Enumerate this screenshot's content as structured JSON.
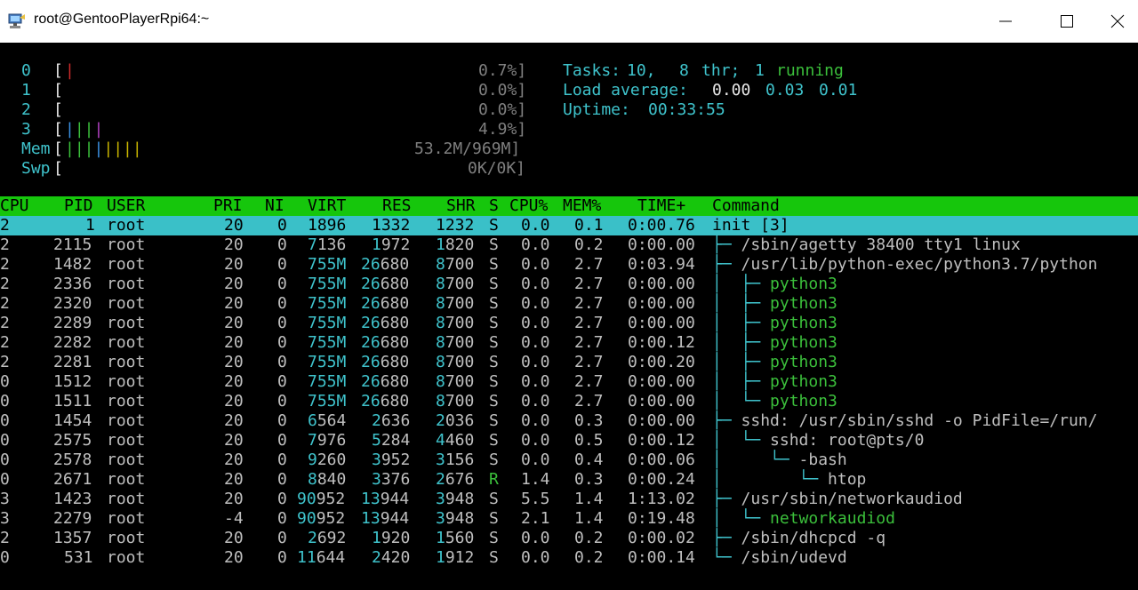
{
  "window": {
    "title": "root@GentooPlayerRpi64:~",
    "icons": [
      "app-icon",
      "minimize-icon",
      "maximize-icon",
      "close-icon"
    ]
  },
  "meters": {
    "cpus": [
      {
        "label": "0",
        "percent": "0.7%]"
      },
      {
        "label": "1",
        "percent": "0.0%]"
      },
      {
        "label": "2",
        "percent": "0.0%]"
      },
      {
        "label": "3",
        "percent": "4.9%]"
      }
    ],
    "mem": {
      "label": "Mem",
      "value": "53.2M/969M]"
    },
    "swp": {
      "label": "Swp",
      "value": "0K/0K]"
    }
  },
  "stats": {
    "tasks_label": "Tasks:",
    "tasks_value": "10,",
    "threads_value": "8",
    "threads_label": "thr;",
    "running_value": "1",
    "running_label": "running",
    "load_label": "Load average:",
    "load1": "0.00",
    "load5": "0.03",
    "load15": "0.01",
    "uptime_label": "Uptime:",
    "uptime_value": "00:33:55"
  },
  "table": {
    "headers": {
      "cpu": "CPU",
      "pid": "PID",
      "user": "USER",
      "pri": "PRI",
      "ni": "NI",
      "virt": "VIRT",
      "res": "RES",
      "shr": "SHR",
      "s": "S",
      "cpup": "CPU%",
      "memp": "MEM%",
      "time": "TIME+",
      "cmd": "Command"
    },
    "rows": [
      {
        "cpu": "2",
        "pid": "1",
        "user": "root",
        "pri": "20",
        "ni": "0",
        "virt": "1896",
        "res": "1332",
        "shr": "1232",
        "s": "S",
        "cpup": "0.0",
        "memp": "0.1",
        "time": "0:00.76",
        "tree": "",
        "cmd": "init [3]"
      },
      {
        "cpu": "2",
        "pid": "2115",
        "user": "root",
        "pri": "20",
        "ni": "0",
        "virt": "7136",
        "res": "1972",
        "shr": "1820",
        "s": "S",
        "cpup": "0.0",
        "memp": "0.2",
        "time": "0:00.00",
        "tree": "├─ ",
        "cmd": "/sbin/agetty 38400 tty1 linux"
      },
      {
        "cpu": "2",
        "pid": "1482",
        "user": "root",
        "pri": "20",
        "ni": "0",
        "virt": "755M",
        "res": "26680",
        "shr": "8700",
        "s": "S",
        "cpup": "0.0",
        "memp": "2.7",
        "time": "0:03.94",
        "tree": "├─ ",
        "cmd": "/usr/lib/python-exec/python3.7/python"
      },
      {
        "cpu": "2",
        "pid": "2336",
        "user": "root",
        "pri": "20",
        "ni": "0",
        "virt": "755M",
        "res": "26680",
        "shr": "8700",
        "s": "S",
        "cpup": "0.0",
        "memp": "2.7",
        "time": "0:00.00",
        "tree": "│  ├─ ",
        "cmd": "python3"
      },
      {
        "cpu": "2",
        "pid": "2320",
        "user": "root",
        "pri": "20",
        "ni": "0",
        "virt": "755M",
        "res": "26680",
        "shr": "8700",
        "s": "S",
        "cpup": "0.0",
        "memp": "2.7",
        "time": "0:00.00",
        "tree": "│  ├─ ",
        "cmd": "python3"
      },
      {
        "cpu": "2",
        "pid": "2289",
        "user": "root",
        "pri": "20",
        "ni": "0",
        "virt": "755M",
        "res": "26680",
        "shr": "8700",
        "s": "S",
        "cpup": "0.0",
        "memp": "2.7",
        "time": "0:00.00",
        "tree": "│  ├─ ",
        "cmd": "python3"
      },
      {
        "cpu": "2",
        "pid": "2282",
        "user": "root",
        "pri": "20",
        "ni": "0",
        "virt": "755M",
        "res": "26680",
        "shr": "8700",
        "s": "S",
        "cpup": "0.0",
        "memp": "2.7",
        "time": "0:00.12",
        "tree": "│  ├─ ",
        "cmd": "python3"
      },
      {
        "cpu": "2",
        "pid": "2281",
        "user": "root",
        "pri": "20",
        "ni": "0",
        "virt": "755M",
        "res": "26680",
        "shr": "8700",
        "s": "S",
        "cpup": "0.0",
        "memp": "2.7",
        "time": "0:00.20",
        "tree": "│  ├─ ",
        "cmd": "python3"
      },
      {
        "cpu": "0",
        "pid": "1512",
        "user": "root",
        "pri": "20",
        "ni": "0",
        "virt": "755M",
        "res": "26680",
        "shr": "8700",
        "s": "S",
        "cpup": "0.0",
        "memp": "2.7",
        "time": "0:00.00",
        "tree": "│  ├─ ",
        "cmd": "python3"
      },
      {
        "cpu": "0",
        "pid": "1511",
        "user": "root",
        "pri": "20",
        "ni": "0",
        "virt": "755M",
        "res": "26680",
        "shr": "8700",
        "s": "S",
        "cpup": "0.0",
        "memp": "2.7",
        "time": "0:00.00",
        "tree": "│  └─ ",
        "cmd": "python3"
      },
      {
        "cpu": "0",
        "pid": "1454",
        "user": "root",
        "pri": "20",
        "ni": "0",
        "virt": "6564",
        "res": "2636",
        "shr": "2036",
        "s": "S",
        "cpup": "0.0",
        "memp": "0.3",
        "time": "0:00.00",
        "tree": "├─ ",
        "cmd": "sshd: /usr/sbin/sshd -o PidFile=/run/"
      },
      {
        "cpu": "0",
        "pid": "2575",
        "user": "root",
        "pri": "20",
        "ni": "0",
        "virt": "7976",
        "res": "5284",
        "shr": "4460",
        "s": "S",
        "cpup": "0.0",
        "memp": "0.5",
        "time": "0:00.12",
        "tree": "│  └─ ",
        "cmd": "sshd: root@pts/0"
      },
      {
        "cpu": "0",
        "pid": "2578",
        "user": "root",
        "pri": "20",
        "ni": "0",
        "virt": "9260",
        "res": "3952",
        "shr": "3156",
        "s": "S",
        "cpup": "0.0",
        "memp": "0.4",
        "time": "0:00.06",
        "tree": "│     └─ ",
        "cmd": "-bash"
      },
      {
        "cpu": "0",
        "pid": "2671",
        "user": "root",
        "pri": "20",
        "ni": "0",
        "virt": "8840",
        "res": "3376",
        "shr": "2676",
        "s": "R",
        "cpup": "1.4",
        "memp": "0.3",
        "time": "0:00.24",
        "tree": "│        └─ ",
        "cmd": "htop"
      },
      {
        "cpu": "3",
        "pid": "1423",
        "user": "root",
        "pri": "20",
        "ni": "0",
        "virt": "90952",
        "res": "13944",
        "shr": "3948",
        "s": "S",
        "cpup": "5.5",
        "memp": "1.4",
        "time": "1:13.02",
        "tree": "├─ ",
        "cmd": "/usr/sbin/networkaudiod"
      },
      {
        "cpu": "3",
        "pid": "2279",
        "user": "root",
        "pri": "-4",
        "ni": "0",
        "virt": "90952",
        "res": "13944",
        "shr": "3948",
        "s": "S",
        "cpup": "2.1",
        "memp": "1.4",
        "time": "0:19.48",
        "tree": "│  └─ ",
        "cmd": "networkaudiod"
      },
      {
        "cpu": "2",
        "pid": "1357",
        "user": "root",
        "pri": "20",
        "ni": "0",
        "virt": "2692",
        "res": "1920",
        "shr": "1560",
        "s": "S",
        "cpup": "0.0",
        "memp": "0.2",
        "time": "0:00.02",
        "tree": "├─ ",
        "cmd": "/sbin/dhcpcd -q"
      },
      {
        "cpu": "0",
        "pid": "531",
        "user": "root",
        "pri": "20",
        "ni": "0",
        "virt": "11644",
        "res": "2420",
        "shr": "1912",
        "s": "S",
        "cpup": "0.0",
        "memp": "0.2",
        "time": "0:00.14",
        "tree": "└─ ",
        "cmd": "/sbin/udevd"
      }
    ]
  }
}
